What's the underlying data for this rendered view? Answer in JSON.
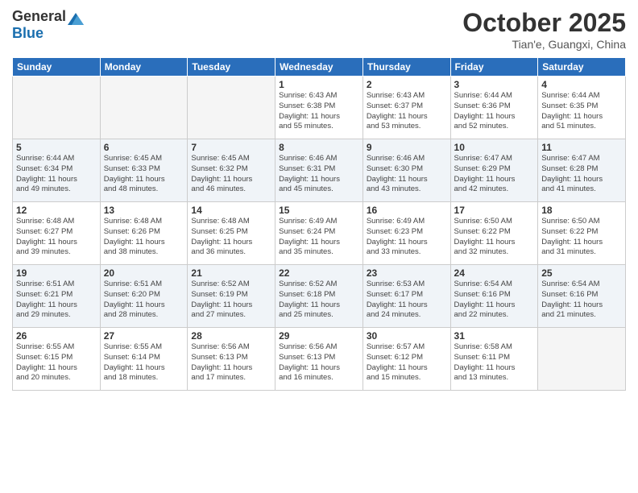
{
  "header": {
    "logo_general": "General",
    "logo_blue": "Blue",
    "month": "October 2025",
    "location": "Tian'e, Guangxi, China"
  },
  "weekdays": [
    "Sunday",
    "Monday",
    "Tuesday",
    "Wednesday",
    "Thursday",
    "Friday",
    "Saturday"
  ],
  "weeks": [
    [
      {
        "day": "",
        "info": ""
      },
      {
        "day": "",
        "info": ""
      },
      {
        "day": "",
        "info": ""
      },
      {
        "day": "1",
        "info": "Sunrise: 6:43 AM\nSunset: 6:38 PM\nDaylight: 11 hours\nand 55 minutes."
      },
      {
        "day": "2",
        "info": "Sunrise: 6:43 AM\nSunset: 6:37 PM\nDaylight: 11 hours\nand 53 minutes."
      },
      {
        "day": "3",
        "info": "Sunrise: 6:44 AM\nSunset: 6:36 PM\nDaylight: 11 hours\nand 52 minutes."
      },
      {
        "day": "4",
        "info": "Sunrise: 6:44 AM\nSunset: 6:35 PM\nDaylight: 11 hours\nand 51 minutes."
      }
    ],
    [
      {
        "day": "5",
        "info": "Sunrise: 6:44 AM\nSunset: 6:34 PM\nDaylight: 11 hours\nand 49 minutes."
      },
      {
        "day": "6",
        "info": "Sunrise: 6:45 AM\nSunset: 6:33 PM\nDaylight: 11 hours\nand 48 minutes."
      },
      {
        "day": "7",
        "info": "Sunrise: 6:45 AM\nSunset: 6:32 PM\nDaylight: 11 hours\nand 46 minutes."
      },
      {
        "day": "8",
        "info": "Sunrise: 6:46 AM\nSunset: 6:31 PM\nDaylight: 11 hours\nand 45 minutes."
      },
      {
        "day": "9",
        "info": "Sunrise: 6:46 AM\nSunset: 6:30 PM\nDaylight: 11 hours\nand 43 minutes."
      },
      {
        "day": "10",
        "info": "Sunrise: 6:47 AM\nSunset: 6:29 PM\nDaylight: 11 hours\nand 42 minutes."
      },
      {
        "day": "11",
        "info": "Sunrise: 6:47 AM\nSunset: 6:28 PM\nDaylight: 11 hours\nand 41 minutes."
      }
    ],
    [
      {
        "day": "12",
        "info": "Sunrise: 6:48 AM\nSunset: 6:27 PM\nDaylight: 11 hours\nand 39 minutes."
      },
      {
        "day": "13",
        "info": "Sunrise: 6:48 AM\nSunset: 6:26 PM\nDaylight: 11 hours\nand 38 minutes."
      },
      {
        "day": "14",
        "info": "Sunrise: 6:48 AM\nSunset: 6:25 PM\nDaylight: 11 hours\nand 36 minutes."
      },
      {
        "day": "15",
        "info": "Sunrise: 6:49 AM\nSunset: 6:24 PM\nDaylight: 11 hours\nand 35 minutes."
      },
      {
        "day": "16",
        "info": "Sunrise: 6:49 AM\nSunset: 6:23 PM\nDaylight: 11 hours\nand 33 minutes."
      },
      {
        "day": "17",
        "info": "Sunrise: 6:50 AM\nSunset: 6:22 PM\nDaylight: 11 hours\nand 32 minutes."
      },
      {
        "day": "18",
        "info": "Sunrise: 6:50 AM\nSunset: 6:22 PM\nDaylight: 11 hours\nand 31 minutes."
      }
    ],
    [
      {
        "day": "19",
        "info": "Sunrise: 6:51 AM\nSunset: 6:21 PM\nDaylight: 11 hours\nand 29 minutes."
      },
      {
        "day": "20",
        "info": "Sunrise: 6:51 AM\nSunset: 6:20 PM\nDaylight: 11 hours\nand 28 minutes."
      },
      {
        "day": "21",
        "info": "Sunrise: 6:52 AM\nSunset: 6:19 PM\nDaylight: 11 hours\nand 27 minutes."
      },
      {
        "day": "22",
        "info": "Sunrise: 6:52 AM\nSunset: 6:18 PM\nDaylight: 11 hours\nand 25 minutes."
      },
      {
        "day": "23",
        "info": "Sunrise: 6:53 AM\nSunset: 6:17 PM\nDaylight: 11 hours\nand 24 minutes."
      },
      {
        "day": "24",
        "info": "Sunrise: 6:54 AM\nSunset: 6:16 PM\nDaylight: 11 hours\nand 22 minutes."
      },
      {
        "day": "25",
        "info": "Sunrise: 6:54 AM\nSunset: 6:16 PM\nDaylight: 11 hours\nand 21 minutes."
      }
    ],
    [
      {
        "day": "26",
        "info": "Sunrise: 6:55 AM\nSunset: 6:15 PM\nDaylight: 11 hours\nand 20 minutes."
      },
      {
        "day": "27",
        "info": "Sunrise: 6:55 AM\nSunset: 6:14 PM\nDaylight: 11 hours\nand 18 minutes."
      },
      {
        "day": "28",
        "info": "Sunrise: 6:56 AM\nSunset: 6:13 PM\nDaylight: 11 hours\nand 17 minutes."
      },
      {
        "day": "29",
        "info": "Sunrise: 6:56 AM\nSunset: 6:13 PM\nDaylight: 11 hours\nand 16 minutes."
      },
      {
        "day": "30",
        "info": "Sunrise: 6:57 AM\nSunset: 6:12 PM\nDaylight: 11 hours\nand 15 minutes."
      },
      {
        "day": "31",
        "info": "Sunrise: 6:58 AM\nSunset: 6:11 PM\nDaylight: 11 hours\nand 13 minutes."
      },
      {
        "day": "",
        "info": ""
      }
    ]
  ]
}
